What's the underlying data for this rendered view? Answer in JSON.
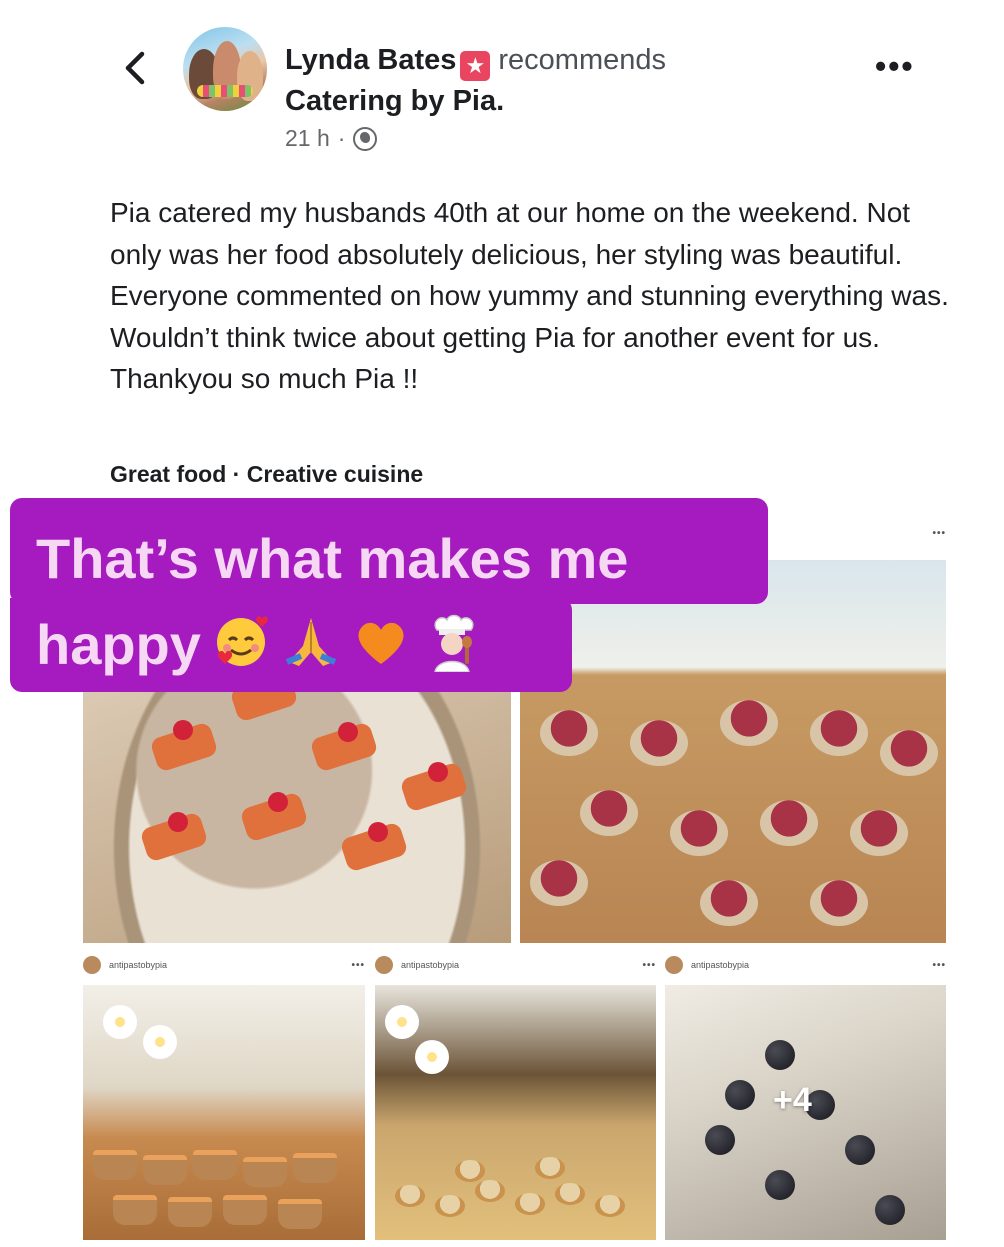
{
  "post": {
    "author": "Lynda Bates",
    "action": "recommends",
    "page": "Catering by Pia.",
    "time": "21 h",
    "separator": "·",
    "body": "Pia catered my husbands 40th at our home on the weekend. Not only was her food absolutely delicious, her styling was beautiful. Everyone commented on how yummy and stunning everything was. Wouldn’t think twice about getting Pia for another event for us. Thankyou so much Pia !!",
    "tags": [
      "Great food",
      "Creative cuisine"
    ],
    "more_label": "•••"
  },
  "overlay": {
    "line1": "That’s what makes me",
    "line2": "happy",
    "emojis": [
      "smiling-face-with-hearts",
      "folded-hands",
      "orange-heart",
      "woman-cook"
    ]
  },
  "photos": {
    "more_count": "+4",
    "mini_account": "antipastobypia",
    "mini_dots": "•••"
  },
  "icons": {
    "back": "chevron-left-icon",
    "recommend": "recommend-star-icon",
    "privacy": "globe-icon",
    "more": "more-options-icon"
  },
  "colors": {
    "overlay_bg": "#a51bbf",
    "overlay_text": "#f6d8f5",
    "recommend_badge": "#e94560",
    "meta_gray": "#65676b"
  }
}
